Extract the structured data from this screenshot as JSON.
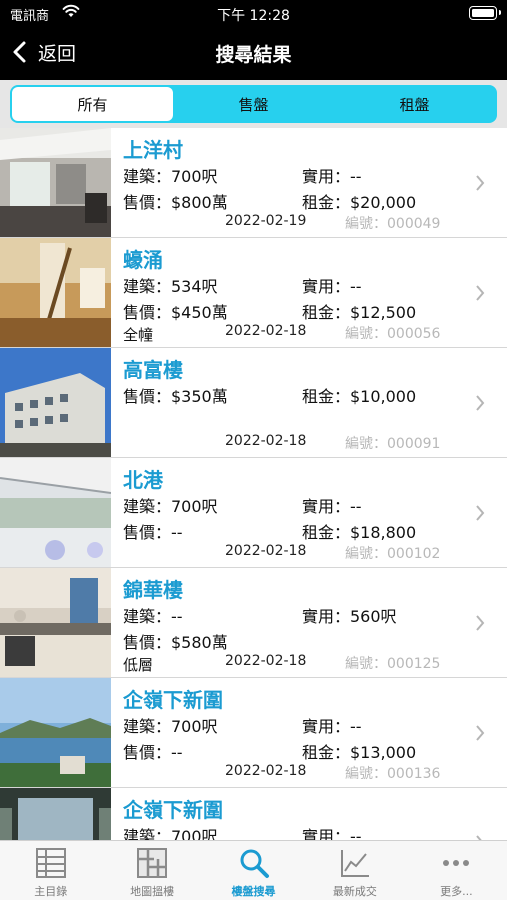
{
  "status_bar": {
    "carrier": "電訊商",
    "time": "下午 12:28"
  },
  "nav": {
    "back_label": "返回",
    "title": "搜尋結果"
  },
  "segments": [
    {
      "label": "所有",
      "active": true
    },
    {
      "label": "售盤",
      "active": false
    },
    {
      "label": "租盤",
      "active": false
    }
  ],
  "listings": [
    {
      "title": "上洋村",
      "build": "建築：700呎",
      "net": "實用：--",
      "price": "售價：$800萬",
      "rent": "租金：$20,000",
      "extra": "",
      "date": "2022-02-19",
      "code": "編號：000049"
    },
    {
      "title": "蠔涌",
      "build": "建築：534呎",
      "net": "實用：--",
      "price": "售價：$450萬",
      "rent": "租金：$12,500",
      "extra": "全幢",
      "date": "2022-02-18",
      "code": "編號：000056"
    },
    {
      "title": "高富樓",
      "build": "",
      "net": "",
      "price": "售價：$350萬",
      "rent": "租金：$10,000",
      "extra": "",
      "date": "2022-02-18",
      "code": "編號：000091"
    },
    {
      "title": "北港",
      "build": "建築：700呎",
      "net": "實用：--",
      "price": "售價：--",
      "rent": "租金：$18,800",
      "extra": "",
      "date": "2022-02-18",
      "code": "編號：000102"
    },
    {
      "title": "錦華樓",
      "build": "建築：--",
      "net": "實用：560呎",
      "price": "售價：$580萬",
      "rent": "",
      "extra": "低層",
      "date": "2022-02-18",
      "code": "編號：000125"
    },
    {
      "title": "企嶺下新圍",
      "build": "建築：700呎",
      "net": "實用：--",
      "price": "售價：--",
      "rent": "租金：$13,000",
      "extra": "",
      "date": "2022-02-18",
      "code": "編號：000136"
    },
    {
      "title": "企嶺下新圍",
      "build": "建築：700呎",
      "net": "實用：--",
      "price": "",
      "rent": "",
      "extra": "",
      "date": "",
      "code": ""
    }
  ],
  "tabbar": [
    {
      "label": "主目錄",
      "icon": "grid-icon",
      "active": false
    },
    {
      "label": "地圖搵樓",
      "icon": "map-icon",
      "active": false
    },
    {
      "label": "樓盤搜尋",
      "icon": "search-icon",
      "active": true
    },
    {
      "label": "最新成交",
      "icon": "chart-icon",
      "active": false
    },
    {
      "label": "更多...",
      "icon": "more-icon",
      "active": false
    }
  ],
  "colors": {
    "accent": "#1b9bd1",
    "segment": "#27d0ee",
    "nav_bg": "#000000"
  }
}
